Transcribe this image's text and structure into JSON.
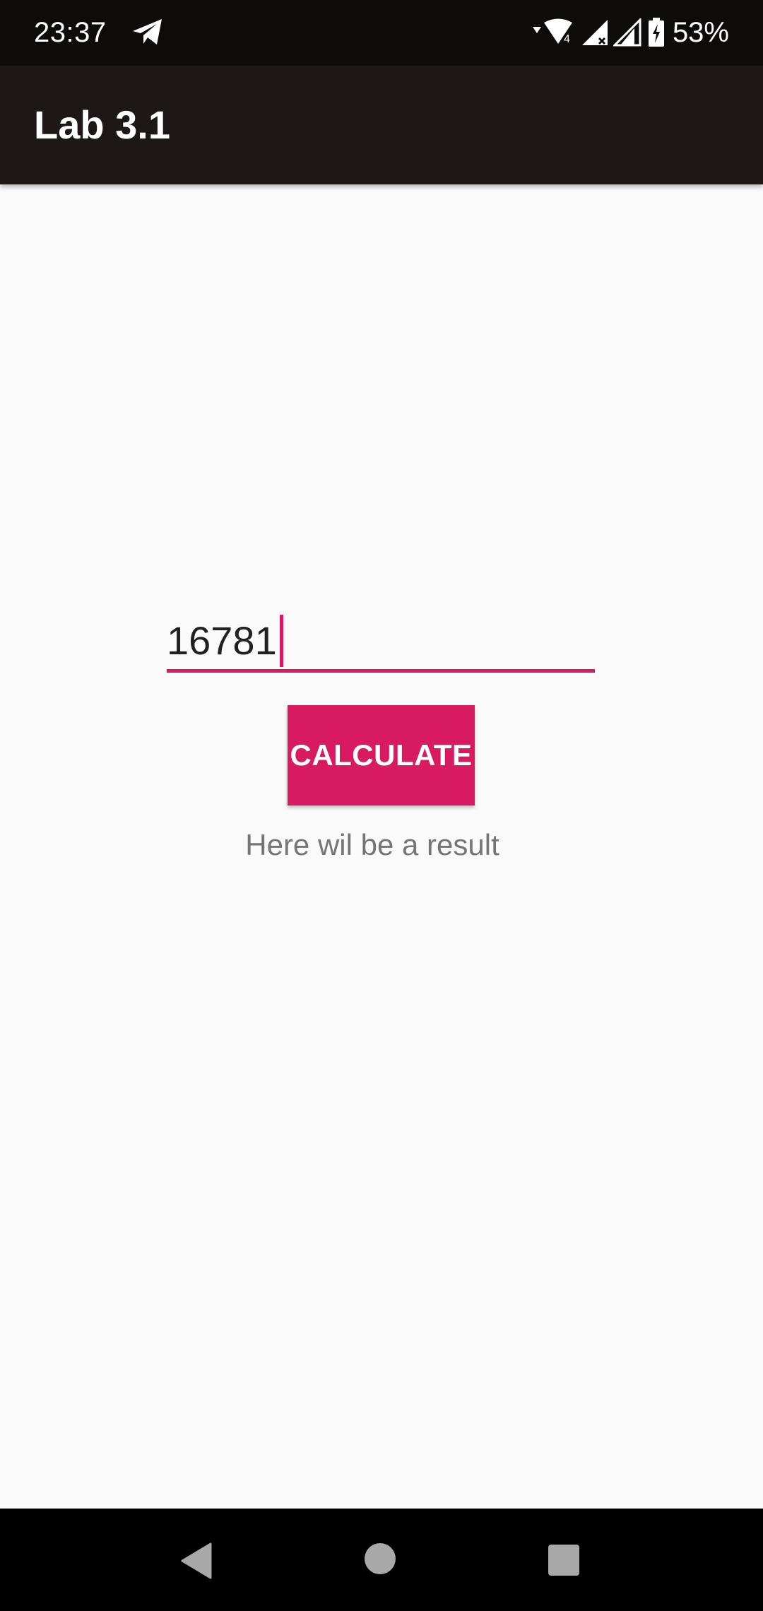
{
  "status_bar": {
    "time": "23:37",
    "battery": "53%",
    "icons": [
      "telegram-icon",
      "wifi-icon",
      "signal-icon",
      "signal-icon",
      "battery-charging-icon"
    ]
  },
  "app_bar": {
    "title": "Lab 3.1"
  },
  "main": {
    "input_value": "16781",
    "button_label": "CALCULATE",
    "result_text": "Here wil be a result"
  },
  "nav_bar": {
    "icons": [
      "back-icon",
      "home-icon",
      "recents-icon"
    ]
  },
  "colors": {
    "accent": "#d81b60",
    "app_bar": "#1e1718",
    "status_bar": "#0e0b0b",
    "background": "#fafafa"
  }
}
